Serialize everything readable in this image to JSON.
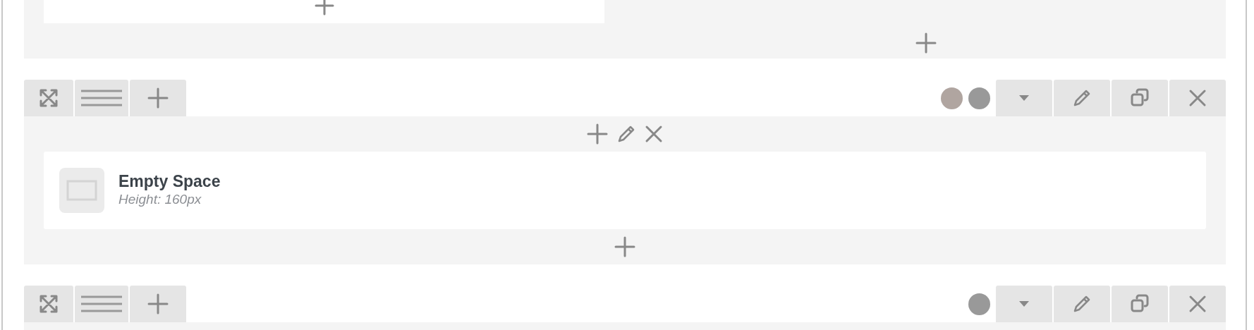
{
  "rows": [
    {
      "status_dots": [
        {
          "color": "#b0a5a0"
        },
        {
          "color": "#999999"
        }
      ],
      "elements": [
        {
          "title": "Empty Space",
          "subtitle": "Height: 160px"
        }
      ]
    },
    {
      "status_dots": [
        {
          "color": "#999999"
        }
      ],
      "elements": []
    }
  ]
}
